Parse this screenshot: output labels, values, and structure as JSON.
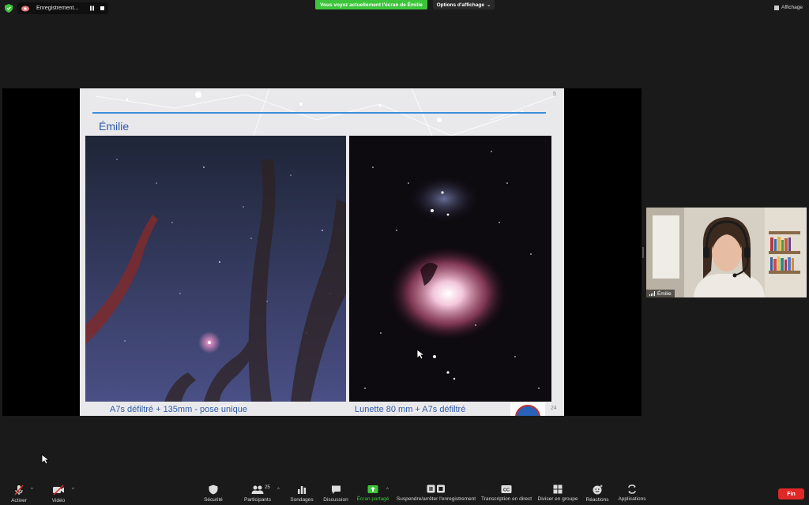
{
  "top_bar": {
    "recording_label": "Enregistrement...",
    "share_banner": "Vous voyez actuellement l'écran de Émilie",
    "view_options": "Options d'affichage",
    "view_options_caret": "⌄",
    "layout_label": "Affichage"
  },
  "slide": {
    "title": "Émilie",
    "caption_left": "A7s défiltré + 135mm  - pose unique",
    "caption_right": "Lunette 80 mm + A7s défiltré",
    "page_number": "24",
    "page_number_top": "5"
  },
  "participant": {
    "name": "Émilie"
  },
  "toolbar": {
    "mute_label": "Activer",
    "video_label": "Vidéo",
    "security_label": "Sécurité",
    "participants_label": "Participants",
    "participants_count": "25",
    "polls_label": "Sondages",
    "chat_label": "Discussion",
    "share_label": "Écran partagé",
    "recording_label": "Suspendre/arrêter l'enregistrement",
    "transcript_label": "Transcription en direct",
    "rooms_label": "Diviser en groupe",
    "reactions_label": "Réactions",
    "apps_label": "Applications",
    "end_label": "Fin",
    "caret": "^"
  },
  "colors": {
    "share_green": "#3cc53a",
    "end_red": "#e02828",
    "slide_blue": "#2f5aa8",
    "rule_blue": "#3a8fdc"
  }
}
